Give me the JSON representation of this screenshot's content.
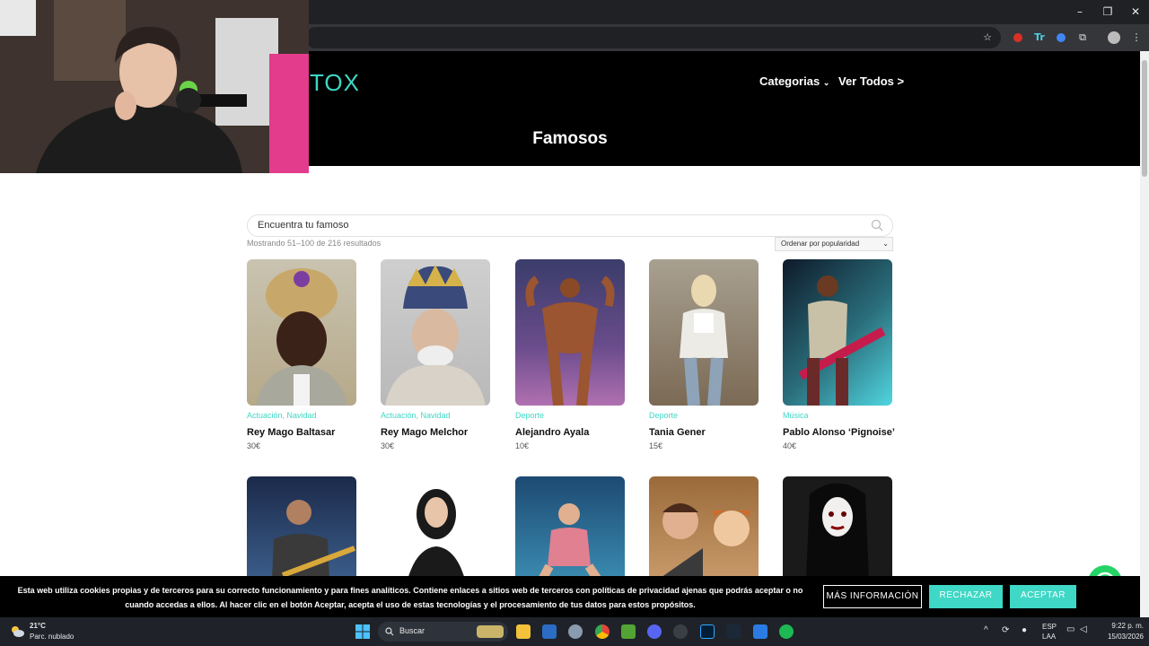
{
  "browser": {
    "window_controls": [
      "–",
      "❐",
      "✕"
    ],
    "toolbar_icons": [
      "star-icon",
      "extension-red-icon",
      "translate-icon",
      "extension-blue-icon",
      "puzzle-icon",
      "profile-avatar",
      "more-icon"
    ]
  },
  "site": {
    "logo_text": "TOX",
    "nav": {
      "categories_label": "Categorias",
      "view_all_label": "Ver Todos >"
    },
    "page_title": "Famosos",
    "search_placeholder": "Encuentra tu famoso",
    "result_count": "Mostrando 51–100 de 216 resultados",
    "sort_selected": "Ordenar por popularidad"
  },
  "products": [
    {
      "categories": [
        "Actuación",
        "Navidad"
      ],
      "name": "Rey Mago Baltasar",
      "price": "30€"
    },
    {
      "categories": [
        "Actuación",
        "Navidad"
      ],
      "name": "Rey Mago Melchor",
      "price": "30€"
    },
    {
      "categories": [
        "Deporte"
      ],
      "name": "Alejandro Ayala",
      "price": "10€"
    },
    {
      "categories": [
        "Deporte"
      ],
      "name": "Tania Gener",
      "price": "15€"
    },
    {
      "categories": [
        "Música"
      ],
      "name": "Pablo Alonso ‘Pignoise’",
      "price": "40€"
    }
  ],
  "cookie": {
    "line1": "Esta web utiliza cookies propias y de terceros para su correcto funcionamiento y para fines analíticos. Contiene enlaces a sitios web de terceros con políticas de privacidad ajenas que podrás aceptar o no",
    "line2": "cuando accedas a ellos. Al hacer clic en el botón Aceptar, acepta el uso de estas tecnologías y el procesamiento de tus datos para estos propósitos.",
    "more_label": "MÁS INFORMACIÓN",
    "reject_label": "RECHAZAR",
    "accept_label": "ACEPTAR",
    "accent_color": "#3fd7c5"
  },
  "taskbar": {
    "weather_temp": "21°C",
    "weather_desc": "Parc. nublado",
    "search_label": "Buscar",
    "lang_top": "ESP",
    "lang_bottom": "LAA",
    "time": "9:22 p. m.",
    "date": "15/03/2026"
  }
}
